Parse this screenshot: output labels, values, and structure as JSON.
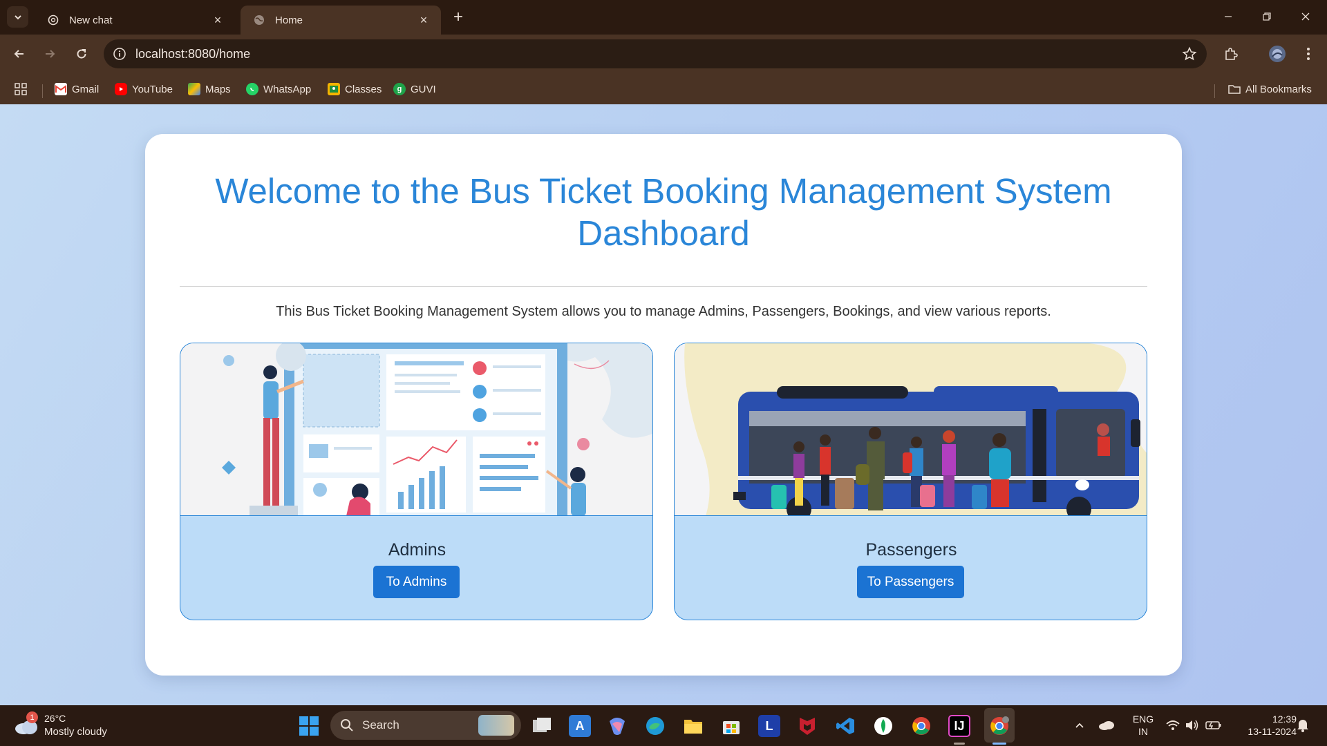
{
  "browser": {
    "tabs": [
      {
        "title": "New chat",
        "favicon": "chatgpt-icon"
      },
      {
        "title": "Home",
        "favicon": "globe-icon",
        "active": true
      }
    ],
    "url": "localhost:8080/home",
    "bookmarks": [
      {
        "label": "Gmail",
        "icon": "gmail-icon",
        "color": "#ea4335"
      },
      {
        "label": "YouTube",
        "icon": "youtube-icon",
        "color": "#ff0000"
      },
      {
        "label": "Maps",
        "icon": "maps-icon",
        "color": "#34a853"
      },
      {
        "label": "WhatsApp",
        "icon": "whatsapp-icon",
        "color": "#25d366"
      },
      {
        "label": "Classes",
        "icon": "classes-icon",
        "color": "#f4b400"
      },
      {
        "label": "GUVI",
        "icon": "guvi-icon",
        "color": "#1fa34a",
        "glyph": "g"
      }
    ],
    "all_bookmarks": "All Bookmarks"
  },
  "page": {
    "title_line1": "Welcome to the Bus Ticket Booking Management System",
    "title_line2": "Dashboard",
    "intro": "This Bus Ticket Booking Management System allows you to manage Admins, Passengers, Bookings, and view various reports.",
    "features": [
      {
        "title": "Admins",
        "button": "To Admins",
        "image": "admin-dashboard-illustration"
      },
      {
        "title": "Passengers",
        "button": "To Passengers",
        "image": "bus-passengers-illustration"
      }
    ],
    "colors": {
      "accent": "#2a86d8",
      "button": "#1b73d3",
      "feature_bg": "#bcdcf8"
    }
  },
  "taskbar": {
    "weather": {
      "badge": "1",
      "temp": "26°C",
      "desc": "Mostly cloudy"
    },
    "search_placeholder": "Search",
    "lang_line1": "ENG",
    "lang_line2": "IN",
    "time": "12:39",
    "date": "13-11-2024"
  }
}
